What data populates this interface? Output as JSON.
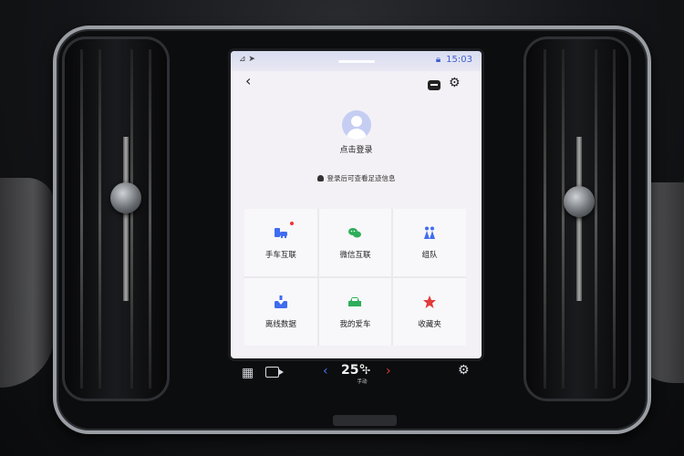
{
  "status_bar": {
    "left_icons": "⊿ ➤",
    "time": "15:03"
  },
  "header": {
    "back_label": "‹"
  },
  "profile": {
    "login_text": "点击登录",
    "hint_text": "登录后可查看足迹信息"
  },
  "tiles": [
    {
      "label": "手车互联",
      "icon": "phone-car-icon",
      "color": "#3f6cf0",
      "badge": true
    },
    {
      "label": "微信互联",
      "icon": "wechat-icon",
      "color": "#2eae5b",
      "badge": false
    },
    {
      "label": "组队",
      "icon": "team-icon",
      "color": "#3f6cf0",
      "badge": false
    },
    {
      "label": "离线数据",
      "icon": "download-icon",
      "color": "#3f6cf0",
      "badge": false
    },
    {
      "label": "我的爱车",
      "icon": "car-icon",
      "color": "#2eae5b",
      "badge": false
    },
    {
      "label": "收藏夹",
      "icon": "star-icon",
      "color": "#e23a3a",
      "badge": false
    }
  ],
  "climate": {
    "temperature": "25°",
    "mode_label": "手动",
    "left_arrow": "‹",
    "right_arrow": "›"
  }
}
